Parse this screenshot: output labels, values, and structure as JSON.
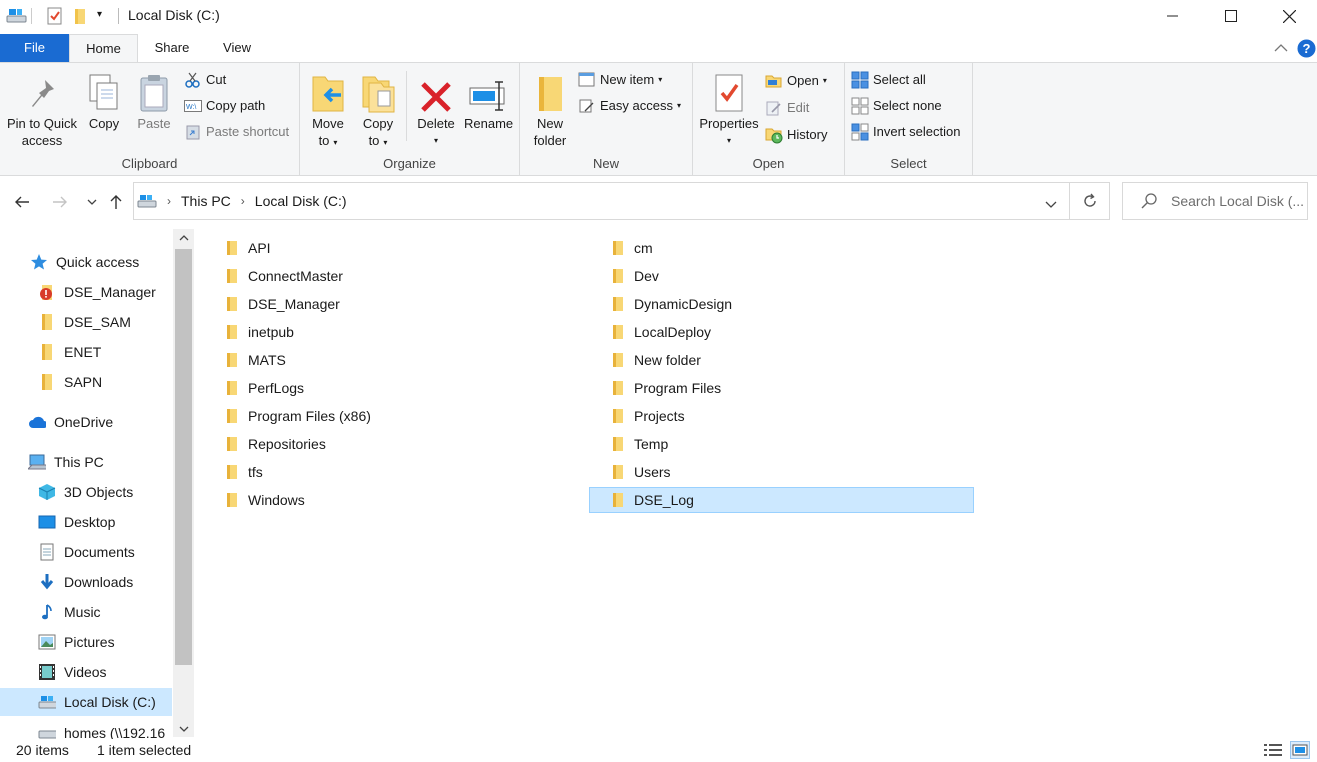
{
  "window": {
    "title": "Local Disk (C:)"
  },
  "ribbon_tabs": {
    "file": "File",
    "home": "Home",
    "share": "Share",
    "view": "View"
  },
  "ribbon": {
    "clipboard": {
      "label": "Clipboard",
      "pin_line1": "Pin to Quick",
      "pin_line2": "access",
      "copy": "Copy",
      "paste": "Paste",
      "cut": "Cut",
      "copy_path": "Copy path",
      "paste_shortcut": "Paste shortcut"
    },
    "organize": {
      "label": "Organize",
      "move_line1": "Move",
      "move_line2": "to",
      "copy_line1": "Copy",
      "copy_line2": "to",
      "delete": "Delete",
      "rename": "Rename"
    },
    "new": {
      "label": "New",
      "folder_line1": "New",
      "folder_line2": "folder",
      "new_item": "New item",
      "easy_access": "Easy access"
    },
    "open": {
      "label": "Open",
      "properties": "Properties",
      "open": "Open",
      "edit": "Edit",
      "history": "History"
    },
    "select": {
      "label": "Select",
      "select_all": "Select all",
      "select_none": "Select none",
      "invert": "Invert selection"
    }
  },
  "address": {
    "crumbs": [
      "This PC",
      "Local Disk (C:)"
    ],
    "search_placeholder": "Search Local Disk (..."
  },
  "nav_pane": {
    "items": [
      {
        "label": "Quick access",
        "icon": "star-icon"
      },
      {
        "label": "DSE_Manager",
        "icon": "folder-error-icon"
      },
      {
        "label": "DSE_SAM",
        "icon": "folder-icon"
      },
      {
        "label": "ENET",
        "icon": "folder-icon"
      },
      {
        "label": "SAPN",
        "icon": "folder-icon"
      },
      {
        "label": "OneDrive",
        "icon": "cloud-icon"
      },
      {
        "label": "This PC",
        "icon": "computer-icon"
      },
      {
        "label": "3D Objects",
        "icon": "cube-icon"
      },
      {
        "label": "Desktop",
        "icon": "desktop-icon"
      },
      {
        "label": "Documents",
        "icon": "documents-icon"
      },
      {
        "label": "Downloads",
        "icon": "download-icon"
      },
      {
        "label": "Music",
        "icon": "music-icon"
      },
      {
        "label": "Pictures",
        "icon": "pictures-icon"
      },
      {
        "label": "Videos",
        "icon": "videos-icon"
      },
      {
        "label": "Local Disk (C:)",
        "icon": "drive-icon"
      },
      {
        "label": "homes (\\\\192.16",
        "icon": "network-drive-icon"
      }
    ]
  },
  "files": {
    "col1": [
      "API",
      "ConnectMaster",
      "DSE_Manager",
      "inetpub",
      "MATS",
      "PerfLogs",
      "Program Files (x86)",
      "Repositories",
      "tfs",
      "Windows"
    ],
    "col2": [
      "cm",
      "Dev",
      "DynamicDesign",
      "LocalDeploy",
      "New folder",
      "Program Files",
      "Projects",
      "Temp",
      "Users",
      "DSE_Log"
    ]
  },
  "status": {
    "count": "20 items",
    "selected": "1 item selected"
  },
  "colors": {
    "accent": "#1a6bd2",
    "selection": "#cce8ff",
    "folder": "#f8d775"
  }
}
